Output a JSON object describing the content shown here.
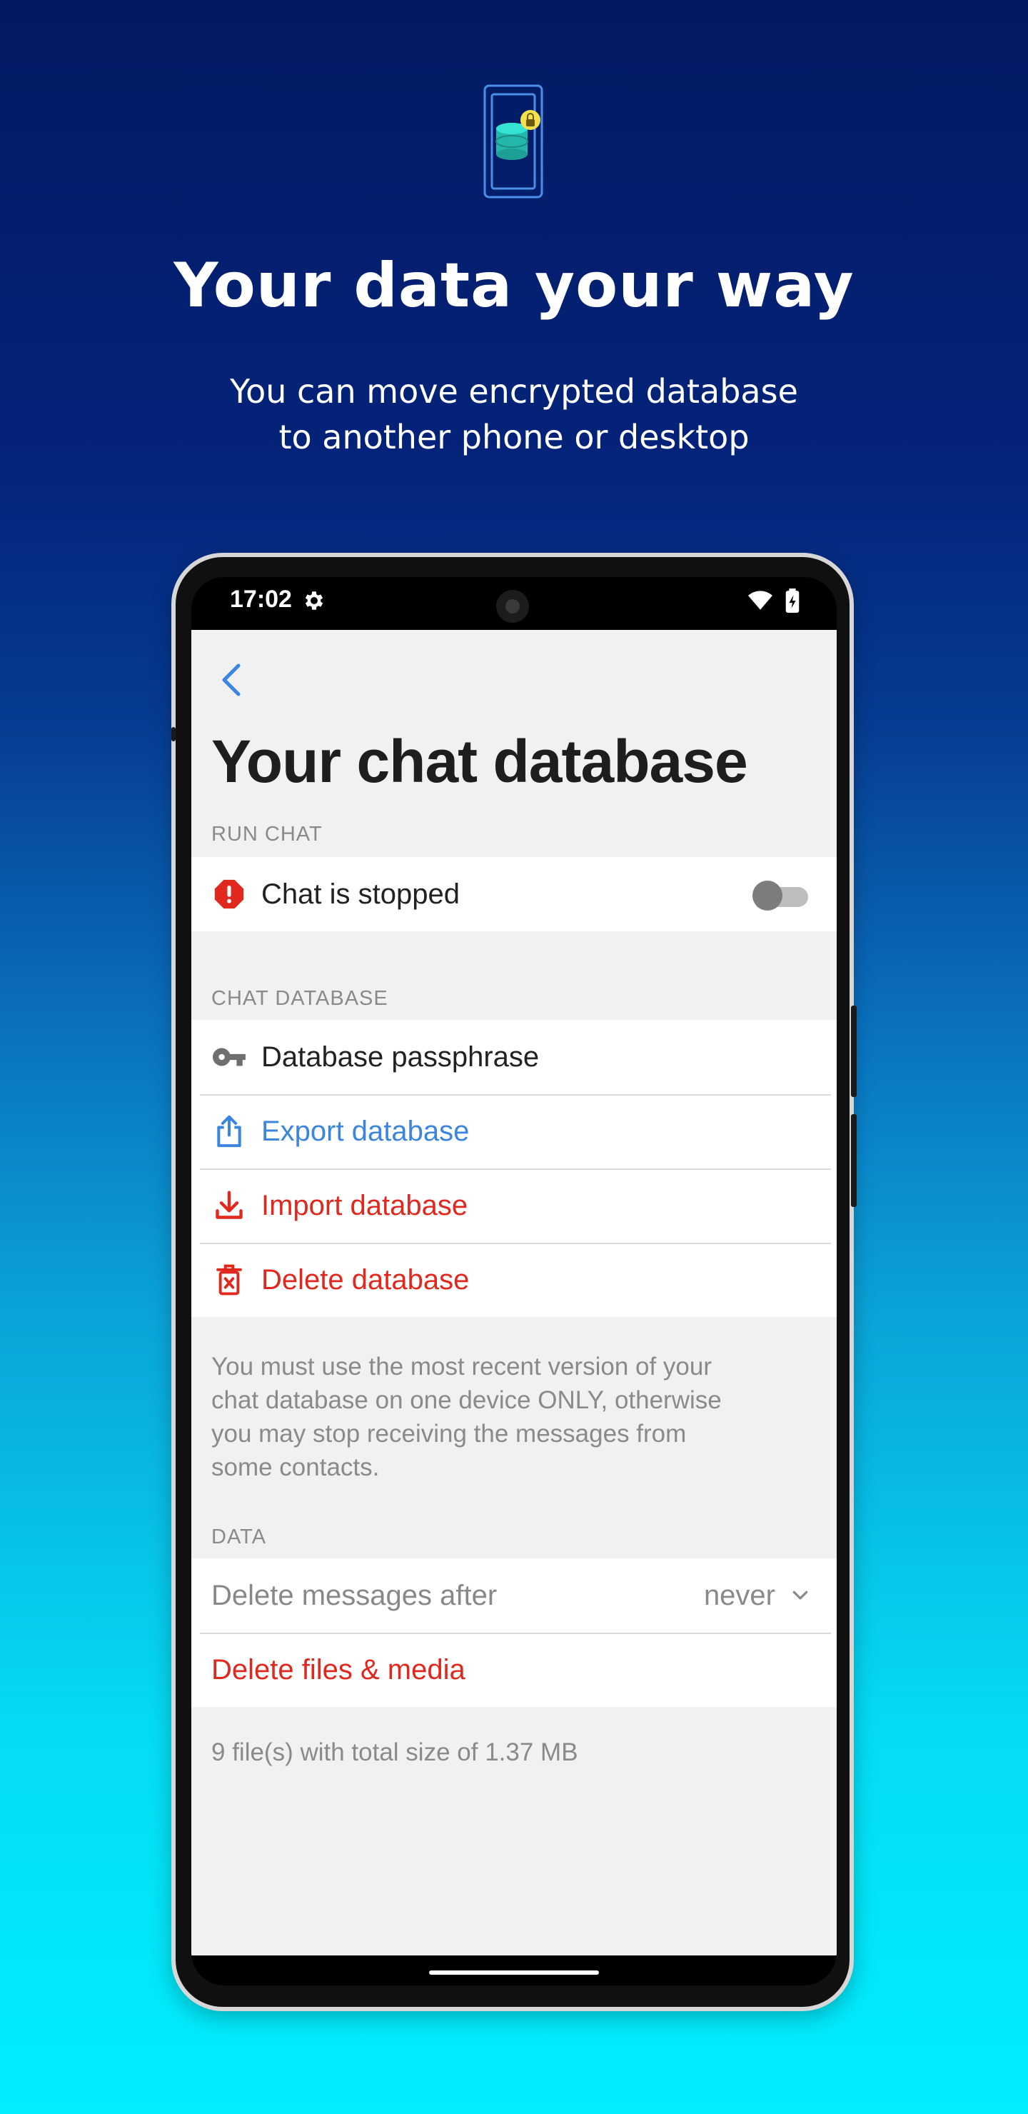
{
  "promo": {
    "headline": "Your data your way",
    "subheadline": "You can move encrypted database\nto another phone or desktop"
  },
  "status_bar": {
    "time": "17:02"
  },
  "screen": {
    "title": "Your chat database",
    "run_chat": {
      "header": "RUN CHAT",
      "label": "Chat is stopped",
      "toggle_on": false
    },
    "chat_database": {
      "header": "CHAT DATABASE",
      "items": [
        {
          "label": "Database passphrase",
          "icon": "key-icon",
          "color": "#222222"
        },
        {
          "label": "Export database",
          "icon": "share-icon",
          "color": "#3a85de"
        },
        {
          "label": "Import database",
          "icon": "download-icon",
          "color": "#e0281e"
        },
        {
          "label": "Delete database",
          "icon": "trash-icon",
          "color": "#e0281e"
        }
      ],
      "note": "You must use the most recent version of your chat database on one device ONLY, otherwise you may stop receiving the messages from some contacts."
    },
    "data": {
      "header": "DATA",
      "delete_after_label": "Delete messages after",
      "delete_after_value": "never",
      "delete_files_label": "Delete files & media",
      "files_summary": "9 file(s) with total size of 1.37 MB"
    }
  },
  "colors": {
    "accent_blue": "#3a85de",
    "danger_red": "#e0281e",
    "background_top": "#031a62",
    "background_bottom": "#00eefe"
  }
}
